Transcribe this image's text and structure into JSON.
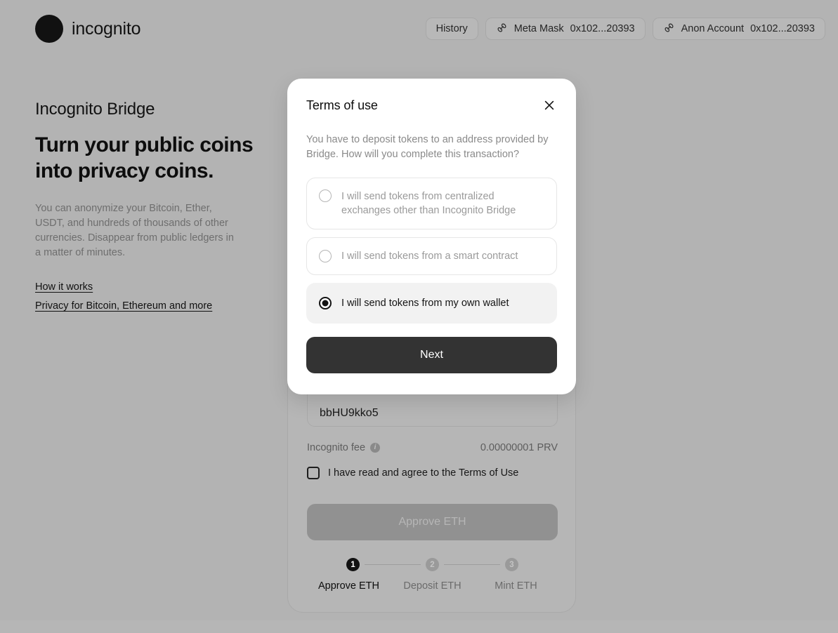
{
  "header": {
    "brand": "incognito",
    "brand_dot_icon": "circle-logo-icon",
    "history_label": "History",
    "wallets": [
      {
        "icon": "link-icon",
        "name": "Meta Mask",
        "address": "0x102...20393"
      },
      {
        "icon": "link-icon",
        "name": "Anon Account",
        "address": "0x102...20393"
      }
    ]
  },
  "hero": {
    "eyebrow": "Incognito Bridge",
    "title": "Turn your public coins into privacy coins.",
    "body": "You can anonymize your Bitcoin, Ether, USDT, and hundreds of thousands of other currencies. Disappear from public ledgers in a matter of minutes.",
    "links": [
      "How it works",
      "Privacy for Bitcoin, Ethereum and more"
    ]
  },
  "card": {
    "address_value": "bbHU9kko5",
    "fee_label": "Incognito fee",
    "fee_info_icon": "info-icon",
    "fee_value": "0.00000001 PRV",
    "agree_label": "I have read and agree to the Terms of Use",
    "agree_checked": false,
    "approve_button": "Approve ETH",
    "approve_disabled": true,
    "stepper": {
      "steps": [
        {
          "number": "1",
          "label": "Approve ETH",
          "state": "active"
        },
        {
          "number": "2",
          "label": "Deposit ETH",
          "state": "inactive"
        },
        {
          "number": "3",
          "label": "Mint ETH",
          "state": "inactive"
        }
      ]
    }
  },
  "modal": {
    "title": "Terms of use",
    "close_icon": "close-icon",
    "description": "You have to deposit tokens to an address provided by Bridge. How will you complete this transaction?",
    "options": [
      {
        "label": "I will send tokens from centralized exchanges other than Incognito Bridge",
        "selected": false
      },
      {
        "label": "I will send tokens from a smart contract",
        "selected": false
      },
      {
        "label": "I will send tokens from my own wallet",
        "selected": true
      }
    ],
    "next_button": "Next"
  },
  "colors": {
    "page_bg": "#b3b3b3",
    "card_bg": "#b6b6b6",
    "modal_bg": "#ffffff",
    "accent_dark": "#333333",
    "selected_option_bg": "#f2f2f2"
  }
}
